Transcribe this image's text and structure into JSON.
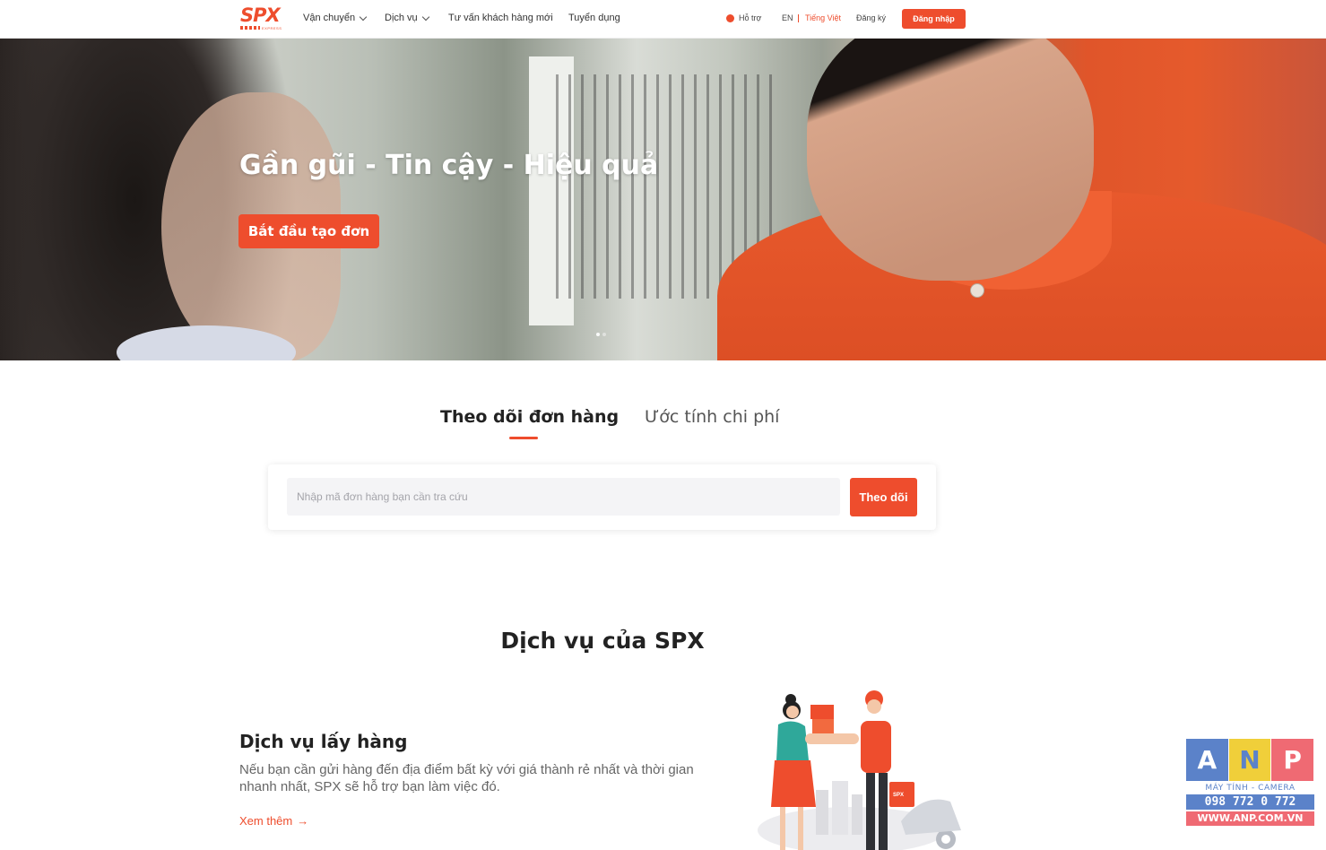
{
  "header": {
    "logo": {
      "text": "SPX",
      "subtext": "EXPRESS"
    },
    "nav": [
      {
        "label": "Vận chuyển",
        "has_dropdown": true
      },
      {
        "label": "Dịch vụ",
        "has_dropdown": true
      },
      {
        "label": "Tư vấn khách hàng mới",
        "has_dropdown": false
      },
      {
        "label": "Tuyển dụng",
        "has_dropdown": false
      }
    ],
    "support_label": "Hỗ trợ",
    "lang_en": "EN",
    "lang_vi": "Tiếng Việt",
    "signup_label": "Đăng ký",
    "login_label": "Đăng nhập"
  },
  "hero": {
    "title": "Gần gũi - Tin cậy - Hiệu quả",
    "cta_label": "Bắt đầu tạo đơn",
    "slides_total": 2,
    "active_slide": 1
  },
  "tracking": {
    "tabs": [
      {
        "label": "Theo dõi đơn hàng",
        "active": true
      },
      {
        "label": "Ước tính chi phí",
        "active": false
      }
    ],
    "input_value": "",
    "input_placeholder": "Nhập mã đơn hàng bạn cần tra cứu",
    "button_label": "Theo dõi"
  },
  "services": {
    "section_title": "Dịch vụ của SPX",
    "item": {
      "title": "Dịch vụ lấy hàng",
      "description": "Nếu bạn cần gửi hàng đến địa điểm bất kỳ với giá thành rẻ nhất và thời gian nhanh nhất, SPX sẽ hỗ trợ bạn làm việc đó.",
      "link_label": "Xem thêm",
      "box_label": "SPX"
    }
  },
  "watermark": {
    "letters": [
      "A",
      "N",
      "P"
    ],
    "tagline": "MÁY TÍNH - CAMERA",
    "phone": "098 772 0 772",
    "website": "WWW.ANP.COM.VN"
  },
  "colors": {
    "brand": "#ee4d2d",
    "text_dark": "#222222",
    "text_muted": "#666666"
  }
}
